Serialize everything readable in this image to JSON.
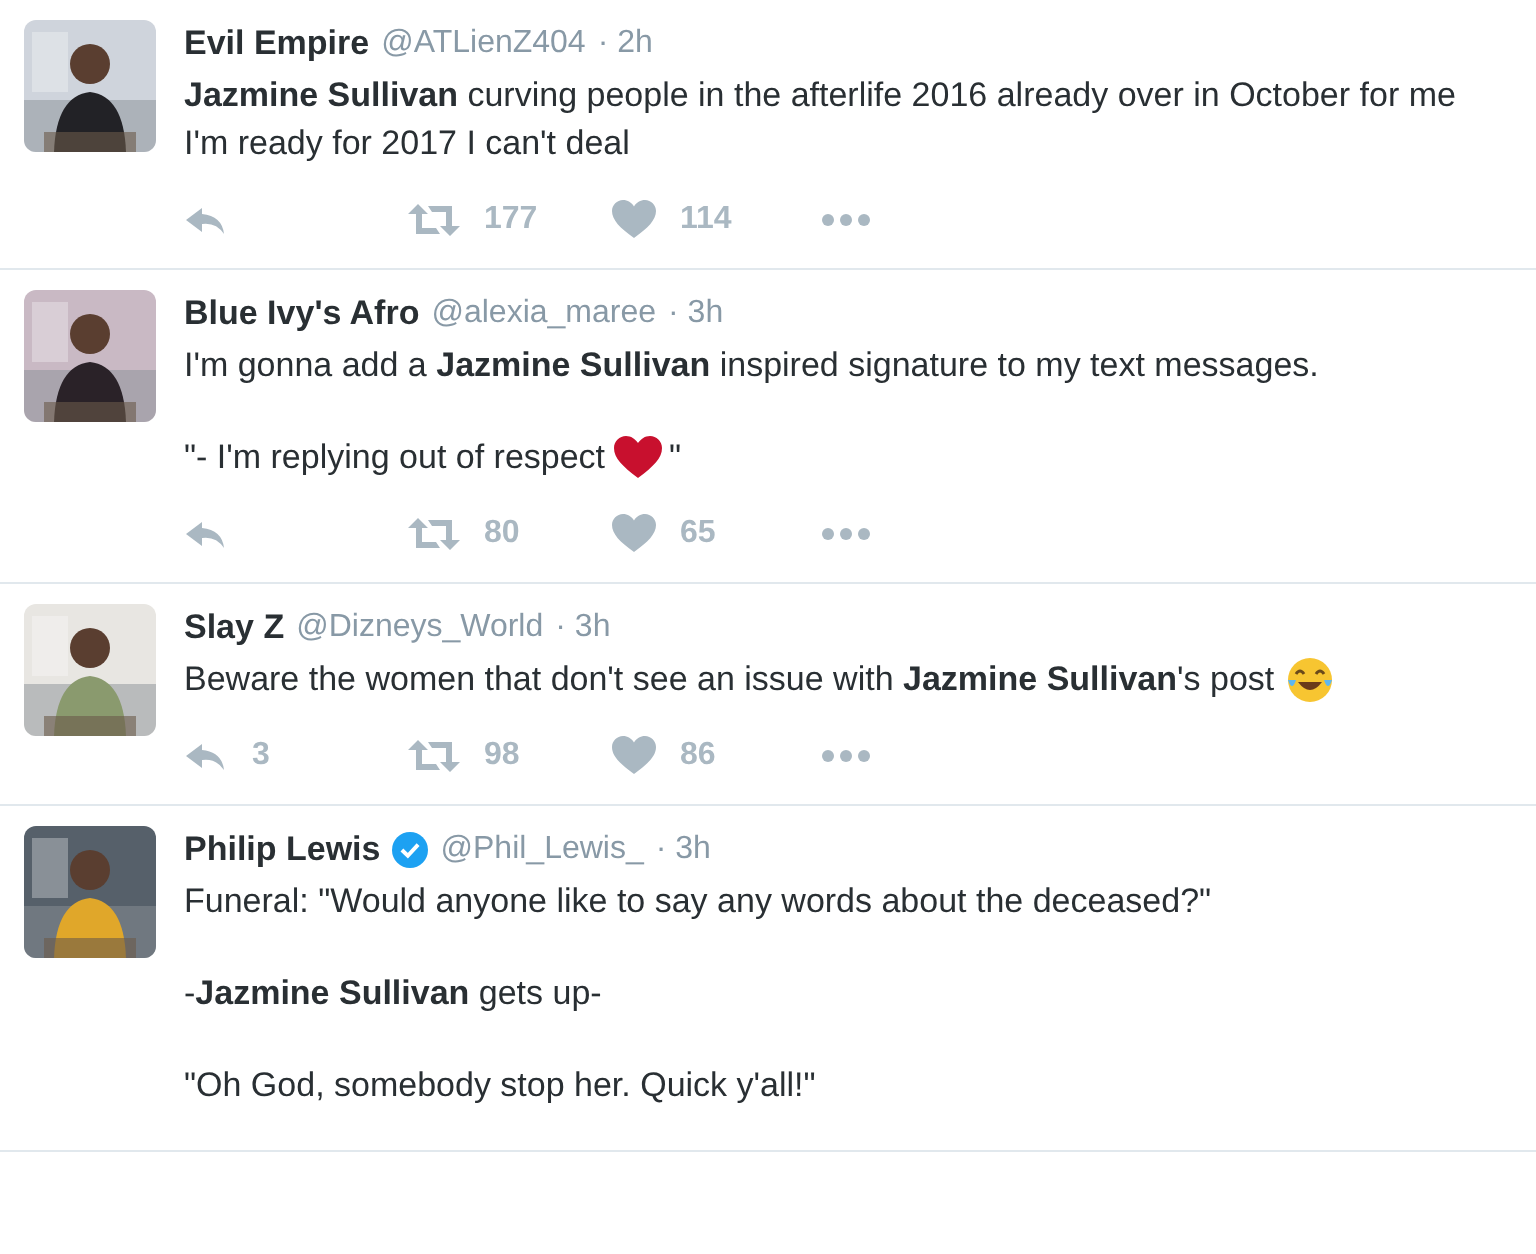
{
  "tweets": [
    {
      "name": "Evil Empire",
      "handle": "@ATLienZ404",
      "time": "· 2h",
      "paragraphs": [
        {
          "text": "**Jazmine Sullivan** curving people in the afterlife 2016 already over in October for me I'm ready for 2017 I can't deal"
        }
      ],
      "actions": {
        "retweets": "177",
        "likes": "114"
      }
    },
    {
      "name": "Blue Ivy's Afro",
      "handle": "@alexia_maree",
      "time": "· 3h",
      "paragraphs": [
        {
          "text": "I'm gonna add a **Jazmine Sullivan** inspired signature to my text messages."
        },
        {
          "text": "\"- I'm replying out of respect",
          "inline_icon": {
            "kind": "heart"
          },
          "tail": "\""
        }
      ],
      "actions": {
        "retweets": "80",
        "likes": "65"
      }
    },
    {
      "name": "Slay Z",
      "handle": "@Dizneys_World",
      "time": "· 3h",
      "paragraphs": [
        {
          "text": "Beware the women that don't see an issue with **Jazmine Sullivan**'s post",
          "inline_icon": {
            "kind": "laughing"
          }
        }
      ],
      "actions": {
        "replies": "3",
        "retweets": "98",
        "likes": "86"
      }
    },
    {
      "name": "Philip Lewis",
      "verified": true,
      "handle": "@Phil_Lewis_",
      "time": "· 3h",
      "paragraphs": [
        {
          "text": "Funeral: \"Would anyone like to say any words about the deceased?\""
        },
        {
          "text": "-**Jazmine Sullivan** gets up-"
        },
        {
          "text": "\"Oh God, somebody stop her. Quick y'all!\""
        }
      ]
    }
  ]
}
